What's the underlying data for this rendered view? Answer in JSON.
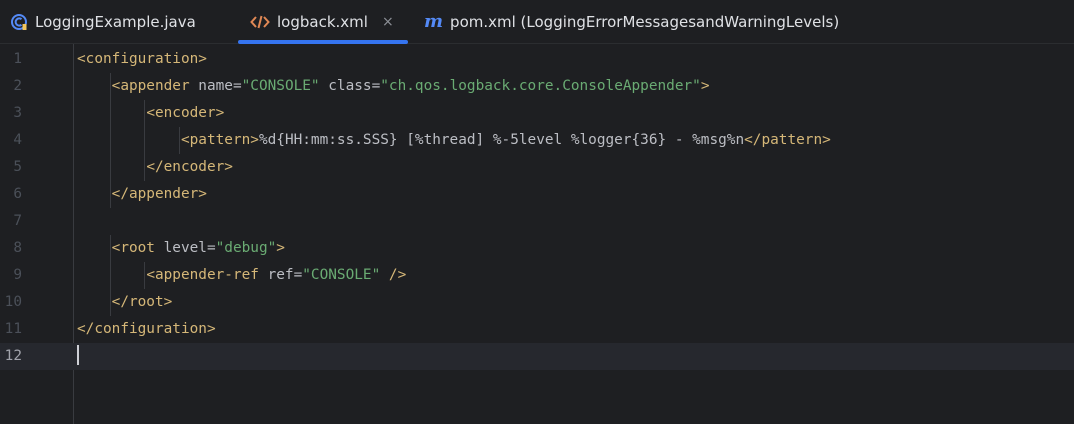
{
  "tabs": [
    {
      "label": "LoggingExample.java",
      "icon": "java-class-icon",
      "active": false
    },
    {
      "label": "logback.xml",
      "icon": "xml-file-icon",
      "active": true,
      "close_glyph": "×"
    },
    {
      "label": "pom.xml (LoggingErrorMessagesandWarningLevels)",
      "icon": "maven-icon",
      "active": false,
      "icon_glyph": "m"
    }
  ],
  "editor": {
    "current_line": 12,
    "lines": [
      {
        "n": "1",
        "tokens": [
          {
            "c": "tag",
            "t": "<configuration>"
          }
        ]
      },
      {
        "n": "2",
        "tokens": [
          {
            "c": "txt",
            "t": "    "
          },
          {
            "c": "tag",
            "t": "<appender "
          },
          {
            "c": "attr",
            "t": "name="
          },
          {
            "c": "val",
            "t": "\"CONSOLE\""
          },
          {
            "c": "attr",
            "t": " class="
          },
          {
            "c": "val",
            "t": "\"ch.qos.logback.core.ConsoleAppender\""
          },
          {
            "c": "tag",
            "t": ">"
          }
        ]
      },
      {
        "n": "3",
        "tokens": [
          {
            "c": "txt",
            "t": "        "
          },
          {
            "c": "tag",
            "t": "<encoder>"
          }
        ]
      },
      {
        "n": "4",
        "tokens": [
          {
            "c": "txt",
            "t": "            "
          },
          {
            "c": "tag",
            "t": "<pattern>"
          },
          {
            "c": "txt",
            "t": "%d{HH:mm:ss.SSS} [%thread] %-5level %logger{36} - %msg%n"
          },
          {
            "c": "tag",
            "t": "</pattern>"
          }
        ]
      },
      {
        "n": "5",
        "tokens": [
          {
            "c": "txt",
            "t": "        "
          },
          {
            "c": "tag",
            "t": "</encoder>"
          }
        ]
      },
      {
        "n": "6",
        "tokens": [
          {
            "c": "txt",
            "t": "    "
          },
          {
            "c": "tag",
            "t": "</appender>"
          }
        ]
      },
      {
        "n": "7",
        "tokens": []
      },
      {
        "n": "8",
        "tokens": [
          {
            "c": "txt",
            "t": "    "
          },
          {
            "c": "tag",
            "t": "<root "
          },
          {
            "c": "attr",
            "t": "level="
          },
          {
            "c": "val",
            "t": "\"debug\""
          },
          {
            "c": "tag",
            "t": ">"
          }
        ]
      },
      {
        "n": "9",
        "tokens": [
          {
            "c": "txt",
            "t": "        "
          },
          {
            "c": "tag",
            "t": "<appender-ref "
          },
          {
            "c": "attr",
            "t": "ref="
          },
          {
            "c": "val",
            "t": "\"CONSOLE\""
          },
          {
            "c": "tag",
            "t": " />"
          }
        ]
      },
      {
        "n": "10",
        "tokens": [
          {
            "c": "txt",
            "t": "    "
          },
          {
            "c": "tag",
            "t": "</root>"
          }
        ]
      },
      {
        "n": "11",
        "tokens": [
          {
            "c": "tag",
            "t": "</configuration>"
          }
        ]
      },
      {
        "n": "12",
        "tokens": []
      }
    ]
  },
  "colors": {
    "background": "#1e1f22",
    "tag": "#d5b778",
    "attribute": "#bcbec4",
    "value": "#6aab73",
    "accent": "#3574f0"
  }
}
